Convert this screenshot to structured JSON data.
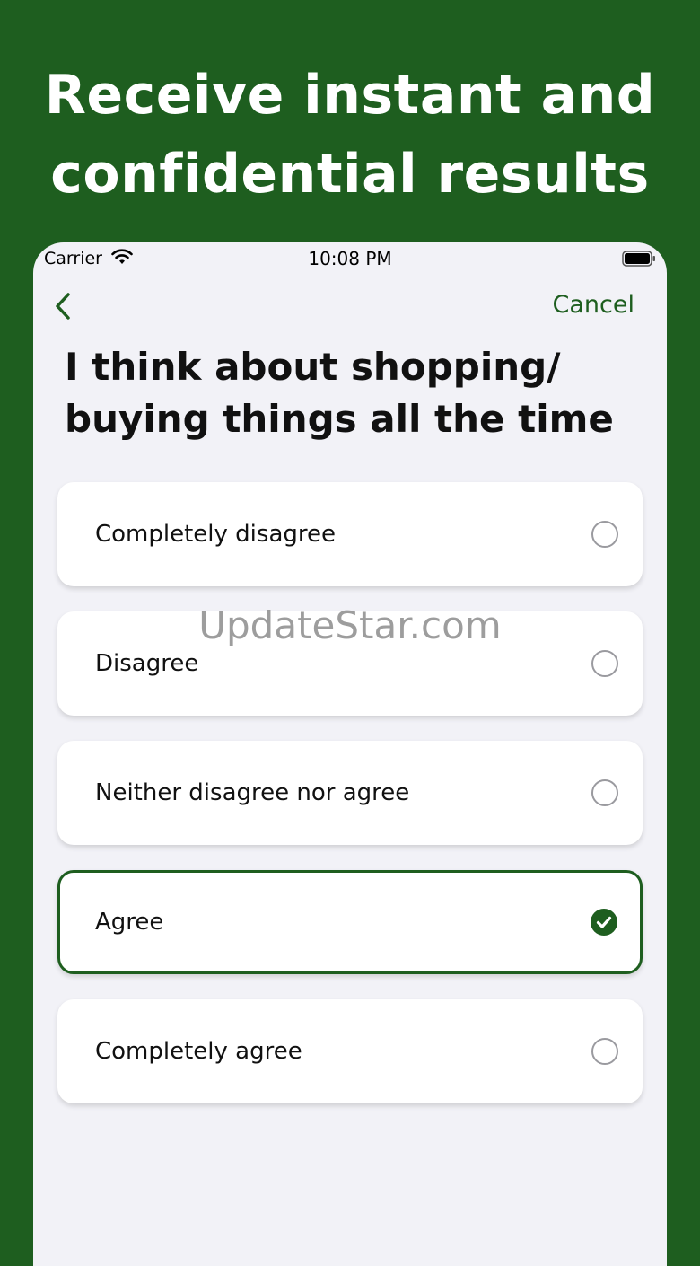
{
  "promo": {
    "line1": "Receive instant and",
    "line2": "confidential results"
  },
  "status_bar": {
    "carrier": "Carrier",
    "time": "10:08 PM"
  },
  "nav": {
    "cancel_label": "Cancel"
  },
  "question": {
    "line1": "I think about shopping/",
    "line2": "buying things all the time"
  },
  "options": [
    {
      "label": "Completely disagree",
      "selected": false
    },
    {
      "label": "Disagree",
      "selected": false
    },
    {
      "label": "Neither disagree nor agree",
      "selected": false
    },
    {
      "label": "Agree",
      "selected": true
    },
    {
      "label": "Completely agree",
      "selected": false
    }
  ],
  "watermark": "UpdateStar.com",
  "colors": {
    "brand_green": "#1e5e1f",
    "background": "#f2f2f7"
  }
}
